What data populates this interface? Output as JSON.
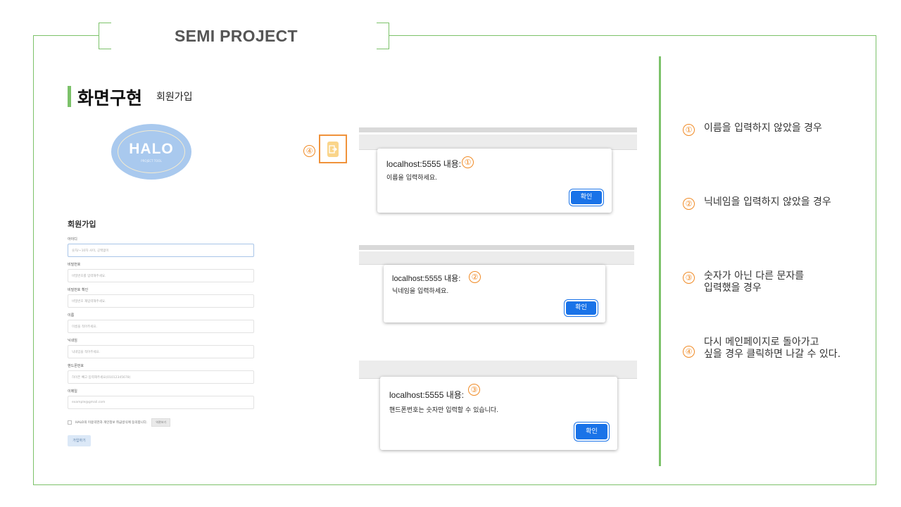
{
  "header": {
    "title": "SEMI PROJECT"
  },
  "section": {
    "title": "화면구현",
    "subtitle": "회원가입"
  },
  "logo": {
    "text": "HALO",
    "sub": "PROJECT TOOL"
  },
  "form": {
    "heading": "회원가입",
    "fields": [
      {
        "label": "아이디",
        "placeholder": "숫자/~10자 사이, 공백없이"
      },
      {
        "label": "비밀번호",
        "placeholder": "비밀번호를 입력해주세요."
      },
      {
        "label": "비밀번호 확인",
        "placeholder": "비밀번호 재입력해주세요."
      },
      {
        "label": "이름",
        "placeholder": "이름을 적어주세요."
      },
      {
        "label": "닉네임",
        "placeholder": "닉네임을 적어주세요."
      },
      {
        "label": "핸드폰번호",
        "placeholder": "하이픈 빼고 입력해주세요(01012345678)"
      },
      {
        "label": "이메일",
        "placeholder": "example@gmail.com"
      }
    ],
    "agree_text": "HALO의 이용약관과 개인정보 취급방식에 동의합니다.",
    "agree_button": "약관보기",
    "submit": "가입하기"
  },
  "markers": {
    "m1": "①",
    "m2": "②",
    "m3": "③",
    "m4": "④"
  },
  "alerts": [
    {
      "title": "localhost:5555 내용:",
      "message": "이름을 입력하세요.",
      "button": "확인"
    },
    {
      "title": "localhost:5555 내용:",
      "message": "닉네임을 입력하세요.",
      "button": "확인"
    },
    {
      "title": "localhost:5555 내용:",
      "message": "핸드폰번호는 숫자만 입력할 수 있습니다.",
      "button": "확인"
    }
  ],
  "descriptions": [
    {
      "num": "①",
      "lines": [
        "이름을 입력하지 않았을 경우"
      ]
    },
    {
      "num": "②",
      "lines": [
        "닉네임을 입력하지 않았을 경우"
      ]
    },
    {
      "num": "③",
      "lines": [
        "숫자가 아닌 다른 문자를",
        "입력했을 경우"
      ]
    },
    {
      "num": "④",
      "lines": [
        "다시 메인페이지로 돌아가고",
        "싶을 경우 클릭하면 나갈 수 있다."
      ]
    }
  ],
  "colors": {
    "accent_green": "#7cc26a",
    "marker_orange": "#f08a24",
    "dialog_button": "#1a73e8"
  }
}
